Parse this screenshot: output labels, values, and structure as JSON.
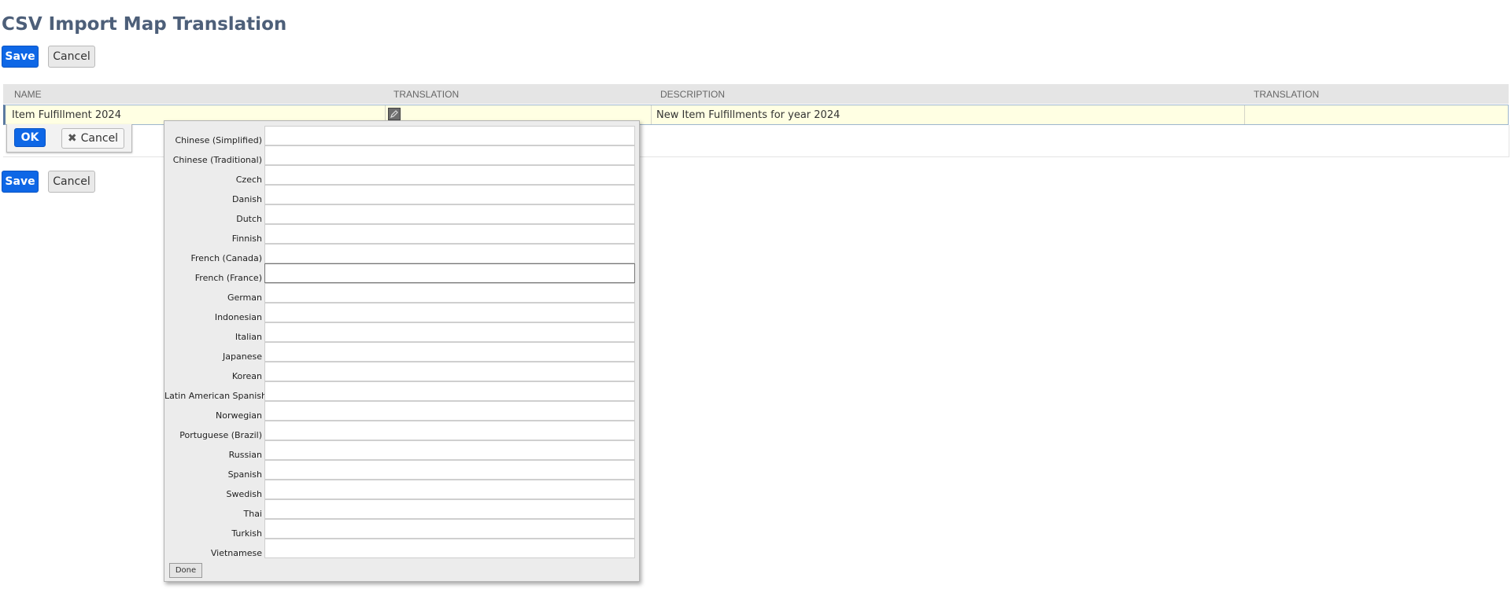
{
  "page": {
    "title": "CSV Import Map Translation"
  },
  "toolbar": {
    "save_label": "Save",
    "cancel_label": "Cancel"
  },
  "grid": {
    "columns": [
      "NAME",
      "TRANSLATION",
      "DESCRIPTION",
      "TRANSLATION"
    ],
    "row": {
      "name": "Item Fulfillment 2024",
      "name_translation_icon": "edit-icon",
      "description": "New Item Fulfillments for year 2024",
      "description_translation": ""
    }
  },
  "row_actions": {
    "ok_label": "OK",
    "cancel_label": "Cancel",
    "cancel_icon": "x-icon"
  },
  "translation_popup": {
    "languages": [
      {
        "label": "Chinese (Simplified)",
        "value": ""
      },
      {
        "label": "Chinese (Traditional)",
        "value": ""
      },
      {
        "label": "Czech",
        "value": ""
      },
      {
        "label": "Danish",
        "value": ""
      },
      {
        "label": "Dutch",
        "value": ""
      },
      {
        "label": "Finnish",
        "value": ""
      },
      {
        "label": "French (Canada)",
        "value": ""
      },
      {
        "label": "French (France)",
        "value": ""
      },
      {
        "label": "German",
        "value": ""
      },
      {
        "label": "Indonesian",
        "value": ""
      },
      {
        "label": "Italian",
        "value": ""
      },
      {
        "label": "Japanese",
        "value": ""
      },
      {
        "label": "Korean",
        "value": ""
      },
      {
        "label": "Latin American Spanish",
        "value": ""
      },
      {
        "label": "Norwegian",
        "value": ""
      },
      {
        "label": "Portuguese (Brazil)",
        "value": ""
      },
      {
        "label": "Russian",
        "value": ""
      },
      {
        "label": "Spanish",
        "value": ""
      },
      {
        "label": "Swedish",
        "value": ""
      },
      {
        "label": "Thai",
        "value": ""
      },
      {
        "label": "Turkish",
        "value": ""
      },
      {
        "label": "Vietnamese",
        "value": ""
      }
    ],
    "done_label": "Done"
  }
}
